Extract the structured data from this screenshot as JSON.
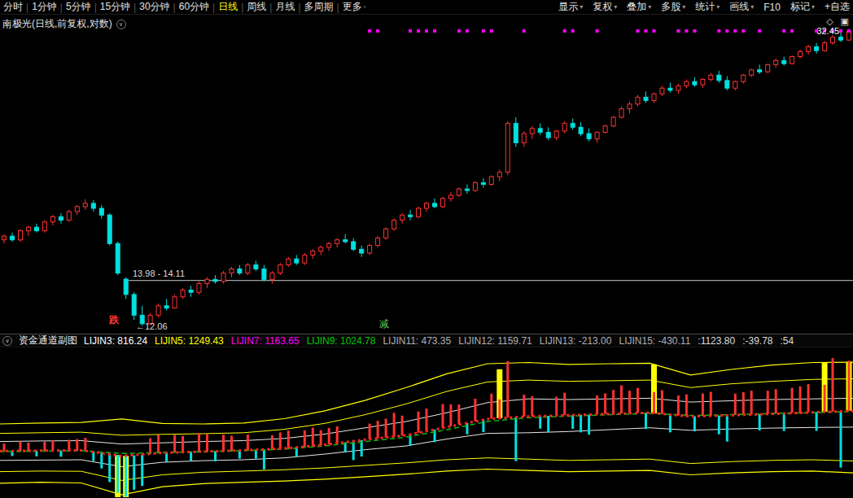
{
  "icons": {
    "chevron_down": "∨",
    "chevron_right": "›",
    "caret": "▾",
    "diamond": "◇",
    "panel": "▣"
  },
  "toolbar": {
    "separator": "|",
    "active_color": "#ffff00",
    "left_items": [
      {
        "label": "分时"
      },
      {
        "label": "1分钟"
      },
      {
        "label": "5分钟"
      },
      {
        "label": "15分钟"
      },
      {
        "label": "30分钟"
      },
      {
        "label": "60分钟"
      },
      {
        "label": "日线",
        "active": true
      },
      {
        "label": "周线"
      },
      {
        "label": "月线"
      },
      {
        "label": "多周期"
      },
      {
        "label": "更多",
        "arrow": true
      }
    ],
    "right_items": [
      {
        "label": "显示",
        "caret": true
      },
      {
        "label": "复权",
        "caret": true
      },
      {
        "label": "叠加",
        "caret": true
      },
      {
        "label": "多股",
        "caret": true
      },
      {
        "label": "统计",
        "caret": true
      },
      {
        "label": "画线",
        "caret": true
      },
      {
        "label": "F10"
      },
      {
        "label": "标记",
        "caret": true
      },
      {
        "label": "+自选"
      }
    ]
  },
  "main_chart": {
    "title": "南极光(日线,前复权,对数)",
    "price_label": "32.45",
    "gap_label": "13.98 - 14.11",
    "low_label": "←12.06",
    "fall_mark": "跌",
    "reduce_mark": "减"
  },
  "indicator": {
    "title": "资金通道副图",
    "values": [
      {
        "label": "LIJIN3",
        "value": "816.24",
        "color": "#ffffff"
      },
      {
        "label": "LIJIN5",
        "value": "1249.43",
        "color": "#ffff00"
      },
      {
        "label": "LIJIN7",
        "value": "1163.65",
        "color": "#ff00ff"
      },
      {
        "label": "LIJIN9",
        "value": "1024.78",
        "color": "#00c800"
      },
      {
        "label": "LIJIN11",
        "value": "473.35",
        "color": "#b0b0b0"
      },
      {
        "label": "LIJIN12",
        "value": "1159.71",
        "color": "#b0b0b0"
      },
      {
        "label": "LIJIN13",
        "value": "-213.00",
        "color": "#b0b0b0"
      },
      {
        "label": "LIJIN15",
        "value": "-430.11",
        "color": "#b0b0b0"
      },
      {
        "label": "",
        "value": "1123.80",
        "color": "#dddddd"
      },
      {
        "label": "",
        "value": "-39.78",
        "color": "#dddddd"
      },
      {
        "label": "",
        "value": "54",
        "color": "#dddddd"
      }
    ]
  },
  "chart_data": [
    {
      "type": "candlestick",
      "title": "南极光(日线,前复权,对数)",
      "scale": "log",
      "ylim": [
        11.75,
        34.3
      ],
      "last_price": 32.45,
      "low_annotation": 12.06,
      "gap_range": [
        13.98,
        14.11
      ],
      "up_color": "#ff3232",
      "down_color": "#00e0e0",
      "mark_color": "#ff00ff",
      "gap_line_color": "#c8c8c8",
      "candles": [
        [
          16.1,
          16.4,
          15.9,
          16.3
        ],
        [
          16.3,
          16.5,
          16.0,
          16.1
        ],
        [
          16.1,
          16.7,
          16.0,
          16.6
        ],
        [
          16.6,
          16.9,
          16.3,
          16.8
        ],
        [
          16.8,
          17.0,
          16.5,
          16.6
        ],
        [
          16.6,
          17.2,
          16.5,
          17.1
        ],
        [
          17.1,
          17.5,
          16.9,
          17.4
        ],
        [
          17.4,
          17.6,
          17.0,
          17.2
        ],
        [
          17.2,
          17.8,
          17.1,
          17.7
        ],
        [
          17.7,
          18.1,
          17.5,
          18.0
        ],
        [
          18.0,
          18.45,
          17.8,
          18.2
        ],
        [
          18.2,
          18.4,
          17.7,
          17.9
        ],
        [
          17.9,
          18.1,
          17.3,
          17.5
        ],
        [
          17.5,
          17.6,
          15.8,
          15.9
        ],
        [
          15.9,
          16.0,
          14.3,
          14.4
        ],
        [
          14.11,
          14.2,
          13.2,
          13.4
        ],
        [
          13.4,
          13.5,
          12.3,
          12.5
        ],
        [
          12.5,
          12.9,
          12.06,
          12.15
        ],
        [
          12.15,
          12.6,
          12.1,
          12.5
        ],
        [
          12.5,
          13.0,
          12.4,
          12.9
        ],
        [
          12.9,
          13.2,
          12.7,
          12.8
        ],
        [
          12.8,
          13.4,
          12.8,
          13.3
        ],
        [
          13.3,
          13.7,
          13.2,
          13.6
        ],
        [
          13.6,
          13.8,
          13.3,
          13.5
        ],
        [
          13.5,
          14.0,
          13.4,
          13.9
        ],
        [
          13.9,
          14.2,
          13.7,
          14.1
        ],
        [
          14.1,
          14.3,
          13.9,
          14.0
        ],
        [
          14.0,
          14.5,
          13.9,
          14.4
        ],
        [
          14.4,
          14.7,
          14.2,
          14.6
        ],
        [
          14.6,
          14.8,
          14.3,
          14.4
        ],
        [
          14.4,
          14.9,
          14.3,
          14.8
        ],
        [
          14.8,
          15.0,
          14.5,
          14.6
        ],
        [
          14.6,
          14.8,
          14.0,
          14.1
        ],
        [
          14.1,
          14.5,
          13.9,
          14.4
        ],
        [
          14.4,
          14.9,
          14.3,
          14.8
        ],
        [
          14.8,
          15.2,
          14.7,
          15.1
        ],
        [
          15.1,
          15.3,
          14.8,
          14.9
        ],
        [
          14.9,
          15.4,
          14.8,
          15.3
        ],
        [
          15.3,
          15.6,
          15.1,
          15.5
        ],
        [
          15.5,
          15.8,
          15.3,
          15.7
        ],
        [
          15.7,
          16.0,
          15.5,
          15.9
        ],
        [
          15.9,
          16.2,
          15.7,
          16.1
        ],
        [
          16.1,
          16.4,
          15.9,
          16.0
        ],
        [
          16.0,
          16.2,
          15.5,
          15.6
        ],
        [
          15.6,
          15.8,
          15.2,
          15.4
        ],
        [
          15.4,
          15.9,
          15.3,
          15.8
        ],
        [
          15.8,
          16.3,
          15.7,
          16.2
        ],
        [
          16.2,
          16.8,
          16.1,
          16.7
        ],
        [
          16.7,
          17.3,
          16.6,
          17.2
        ],
        [
          17.2,
          17.6,
          17.0,
          17.5
        ],
        [
          17.5,
          17.8,
          17.2,
          17.4
        ],
        [
          17.4,
          18.0,
          17.3,
          17.9
        ],
        [
          17.9,
          18.3,
          17.7,
          18.2
        ],
        [
          18.2,
          18.5,
          17.9,
          18.0
        ],
        [
          18.0,
          18.6,
          17.9,
          18.5
        ],
        [
          18.5,
          18.9,
          18.3,
          18.7
        ],
        [
          18.7,
          19.2,
          18.6,
          19.1
        ],
        [
          19.1,
          19.4,
          18.8,
          19.0
        ],
        [
          19.0,
          19.6,
          18.9,
          19.5
        ],
        [
          19.5,
          19.8,
          19.2,
          19.4
        ],
        [
          19.4,
          20.0,
          19.3,
          19.9
        ],
        [
          19.9,
          20.4,
          19.6,
          20.2
        ],
        [
          20.2,
          24.0,
          20.0,
          23.8
        ],
        [
          23.8,
          24.3,
          22.0,
          22.3
        ],
        [
          22.3,
          23.2,
          22.0,
          23.0
        ],
        [
          23.0,
          23.6,
          22.6,
          23.4
        ],
        [
          23.4,
          23.8,
          22.9,
          23.1
        ],
        [
          23.1,
          23.5,
          22.5,
          22.7
        ],
        [
          22.7,
          23.3,
          22.5,
          23.2
        ],
        [
          23.2,
          24.0,
          23.0,
          23.8
        ],
        [
          23.8,
          24.2,
          23.3,
          23.5
        ],
        [
          23.5,
          23.9,
          22.8,
          23.0
        ],
        [
          23.0,
          23.4,
          22.4,
          22.6
        ],
        [
          22.6,
          23.2,
          22.3,
          23.1
        ],
        [
          23.1,
          23.7,
          23.0,
          23.6
        ],
        [
          23.6,
          24.4,
          23.5,
          24.3
        ],
        [
          24.3,
          25.2,
          24.2,
          25.0
        ],
        [
          25.0,
          25.6,
          24.6,
          25.4
        ],
        [
          25.4,
          26.2,
          25.2,
          26.0
        ],
        [
          26.0,
          26.5,
          25.5,
          25.7
        ],
        [
          25.7,
          26.4,
          25.5,
          26.3
        ],
        [
          26.3,
          27.0,
          26.1,
          26.8
        ],
        [
          26.8,
          27.3,
          26.4,
          26.6
        ],
        [
          26.6,
          27.2,
          26.3,
          27.0
        ],
        [
          27.0,
          27.6,
          26.8,
          27.4
        ],
        [
          27.4,
          27.8,
          26.9,
          27.1
        ],
        [
          27.1,
          27.7,
          26.8,
          27.6
        ],
        [
          27.6,
          28.2,
          27.4,
          28.0
        ],
        [
          28.0,
          28.4,
          27.3,
          27.5
        ],
        [
          27.5,
          27.9,
          26.6,
          26.8
        ],
        [
          26.8,
          27.5,
          26.6,
          27.4
        ],
        [
          27.4,
          28.1,
          27.2,
          28.0
        ],
        [
          28.0,
          28.6,
          27.8,
          28.5
        ],
        [
          28.5,
          29.0,
          28.1,
          28.3
        ],
        [
          28.3,
          29.1,
          28.2,
          29.0
        ],
        [
          29.0,
          29.6,
          28.7,
          29.4
        ],
        [
          29.4,
          29.8,
          28.9,
          29.1
        ],
        [
          29.1,
          29.9,
          29.0,
          29.8
        ],
        [
          29.8,
          30.5,
          29.6,
          30.3
        ],
        [
          30.3,
          31.0,
          30.0,
          30.8
        ],
        [
          30.8,
          31.2,
          30.1,
          30.4
        ],
        [
          30.4,
          31.4,
          30.3,
          31.2
        ],
        [
          31.2,
          32.0,
          31.0,
          31.8
        ],
        [
          31.8,
          32.3,
          31.3,
          31.5
        ],
        [
          31.5,
          32.6,
          31.4,
          32.45
        ]
      ],
      "top_marks": [
        45,
        46,
        50,
        51,
        52,
        53,
        56,
        57,
        59,
        60,
        64,
        69,
        70,
        73,
        78,
        79,
        80,
        83,
        84,
        85,
        88,
        89,
        90,
        91,
        93,
        96,
        97,
        100,
        101,
        102,
        103,
        104
      ]
    },
    {
      "type": "line+bar",
      "title": "资金通道副图",
      "ylim": [
        -700,
        1700
      ],
      "bar_up_color": "#ff3232",
      "bar_down_color": "#00e0e0",
      "signal_color": "#ffff00",
      "signal_height": 780,
      "signal_bar_indices": [
        14,
        15,
        61,
        80,
        101,
        104
      ],
      "bar_baseline": "lijin-red",
      "series": [
        {
          "name": "upper-outer",
          "color": "#ffff00",
          "width": 1.2,
          "dash": "",
          "layer": "back",
          "values": [
            480,
            495,
            505,
            560,
            490,
            480,
            495,
            565,
            690,
            860,
            1060,
            1280,
            1440,
            1460,
            1430,
            1440,
            1450,
            1260,
            1350,
            1420,
            1460,
            1464
          ]
        },
        {
          "name": "upper-inner",
          "color": "#ffff00",
          "width": 1,
          "dash": "",
          "layer": "back",
          "values": [
            330,
            340,
            350,
            300,
            315,
            325,
            340,
            395,
            490,
            630,
            800,
            1000,
            1150,
            1180,
            1160,
            1170,
            1180,
            1060,
            1120,
            1160,
            1190,
            1200
          ]
        },
        {
          "name": "white-upper",
          "color": "#e8e8e8",
          "width": 1,
          "dash": "",
          "layer": "back",
          "values": [
            200,
            210,
            215,
            160,
            180,
            200,
            215,
            250,
            320,
            420,
            520,
            660,
            820,
            880,
            870,
            880,
            890,
            830,
            850,
            870,
            880,
            890
          ]
        },
        {
          "name": "white-lower",
          "color": "#e8e8e8",
          "width": 1,
          "dash": "",
          "layer": "back",
          "values": [
            -100,
            -95,
            -90,
            -200,
            -130,
            -105,
            -90,
            -60,
            0,
            70,
            130,
            240,
            330,
            340,
            360,
            390,
            420,
            380,
            400,
            415,
            425,
            430
          ]
        },
        {
          "name": "lower-inner",
          "color": "#ffff00",
          "width": 1,
          "dash": "",
          "layer": "back",
          "values": [
            -280,
            -270,
            -275,
            -420,
            -330,
            -290,
            -270,
            -250,
            -220,
            -180,
            -140,
            -90,
            -60,
            -80,
            -100,
            -90,
            -80,
            -150,
            -120,
            -100,
            -90,
            -110
          ]
        },
        {
          "name": "lower-outer",
          "color": "#ffff00",
          "width": 1.2,
          "dash": "",
          "layer": "back",
          "values": [
            -464,
            -450,
            -460,
            -650,
            -520,
            -470,
            -450,
            -430,
            -400,
            -360,
            -320,
            -270,
            -240,
            -260,
            -280,
            -270,
            -260,
            -330,
            -300,
            -280,
            -270,
            -300
          ]
        },
        {
          "name": "lijin-green",
          "color": "#00bb00",
          "width": 1.5,
          "dash": "6 4",
          "layer": "front",
          "values": [
            40,
            48,
            55,
            10,
            25,
            38,
            55,
            80,
            130,
            200,
            270,
            390,
            520,
            580,
            605,
            628,
            650,
            615,
            628,
            648,
            660,
            680
          ]
        },
        {
          "name": "lijin-red",
          "color": "#ff2222",
          "width": 3,
          "dash": "3 4",
          "layer": "front",
          "values": [
            48,
            55,
            60,
            -30,
            20,
            40,
            60,
            90,
            150,
            230,
            300,
            430,
            560,
            600,
            620,
            640,
            660,
            600,
            620,
            640,
            665,
            690
          ]
        }
      ],
      "bars": [
        120,
        -80,
        150,
        130,
        -90,
        140,
        160,
        -100,
        170,
        180,
        200,
        -150,
        -250,
        -450,
        -600,
        -650,
        -550,
        -500,
        250,
        300,
        -150,
        280,
        260,
        -140,
        300,
        280,
        -160,
        260,
        240,
        -130,
        250,
        -140,
        -320,
        220,
        260,
        280,
        -150,
        260,
        290,
        240,
        260,
        270,
        -150,
        -300,
        -260,
        250,
        280,
        300,
        380,
        320,
        -180,
        340,
        360,
        -200,
        380,
        350,
        320,
        -180,
        360,
        -200,
        400,
        300,
        900,
        -700,
        350,
        320,
        -200,
        -260,
        300,
        360,
        -220,
        -280,
        -320,
        300,
        330,
        380,
        450,
        360,
        400,
        -260,
        340,
        380,
        -280,
        320,
        350,
        -240,
        360,
        380,
        -300,
        -420,
        340,
        360,
        380,
        -260,
        370,
        390,
        -280,
        400,
        420,
        450,
        -300,
        430,
        850,
        -900,
        800
      ]
    }
  ]
}
